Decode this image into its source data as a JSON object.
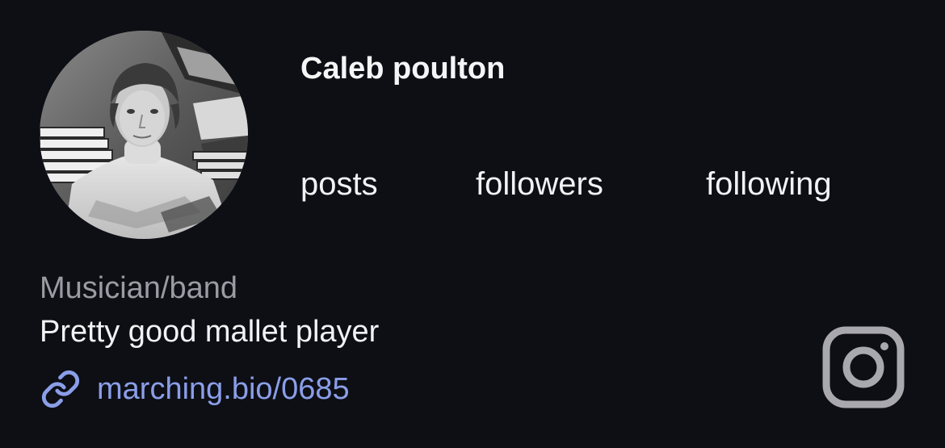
{
  "profile": {
    "name": "Caleb poulton",
    "category": "Musician/band",
    "bio": "Pretty good mallet player",
    "link": "marching.bio/0685",
    "avatar_icon": "profile-photo"
  },
  "stats": {
    "posts_label": "posts",
    "followers_label": "followers",
    "following_label": "following"
  },
  "icons": {
    "link": "link-icon",
    "social": "instagram-icon"
  },
  "colors": {
    "background": "#0d0f15",
    "text": "#f2f2f5",
    "muted": "#9b9ba3",
    "link": "#8b9ee8",
    "icon_gray": "#a9a9ad"
  }
}
